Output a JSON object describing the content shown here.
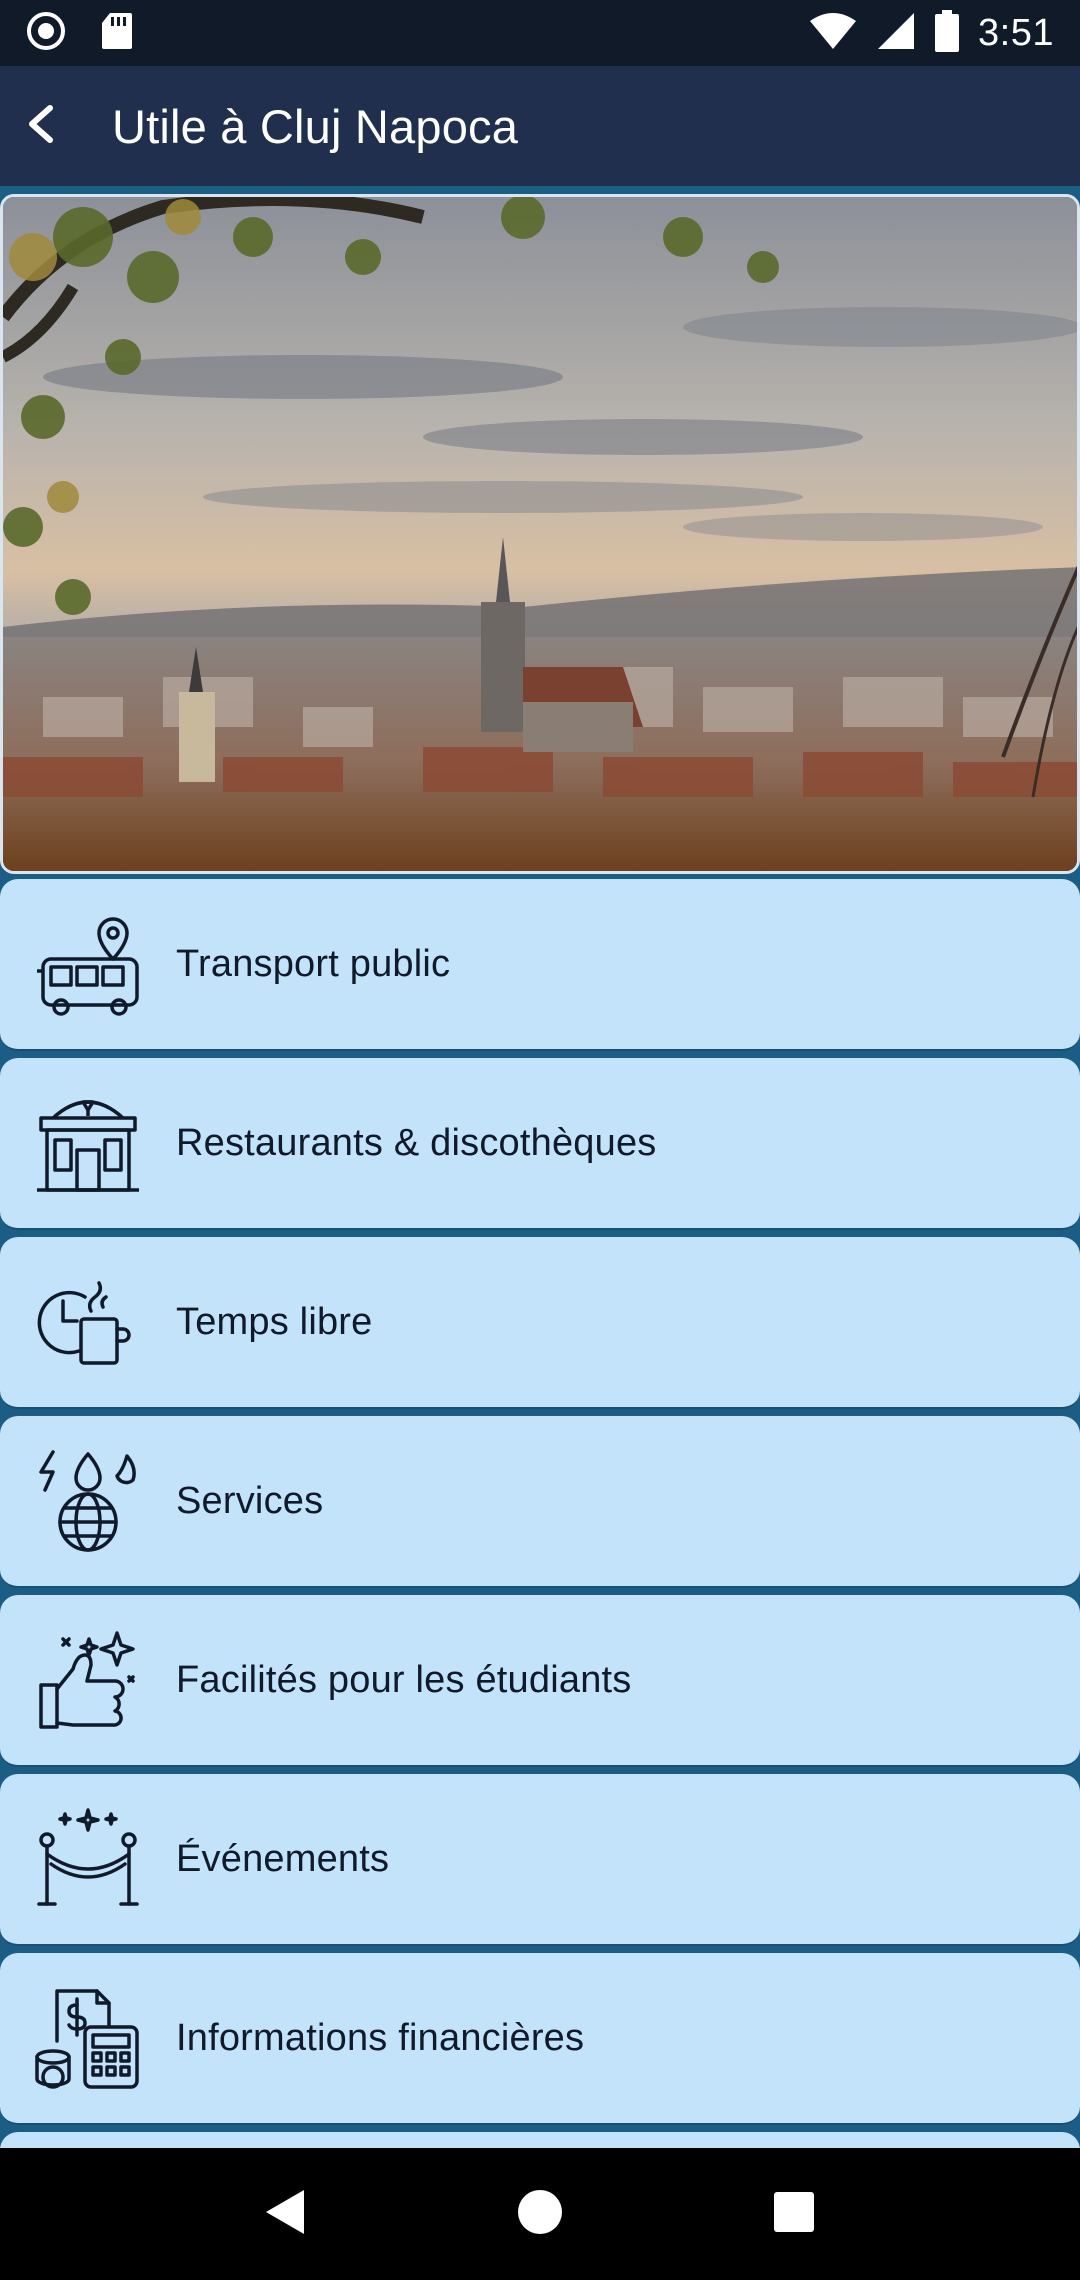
{
  "status_bar": {
    "time": "3:51",
    "icons": [
      "notification-circle-icon",
      "sd-card-icon",
      "wifi-icon",
      "signal-icon",
      "battery-icon"
    ]
  },
  "app_bar": {
    "title": "Utile à Cluj Napoca",
    "back_icon": "back-arrow-icon"
  },
  "hero": {
    "image": "cluj-napoca-cityscape"
  },
  "menu": [
    {
      "label": "Transport public",
      "icon": "bus-location-icon"
    },
    {
      "label": "Restaurants & discothèques",
      "icon": "restaurant-building-icon"
    },
    {
      "label": "Temps libre",
      "icon": "clock-coffee-icon"
    },
    {
      "label": "Services",
      "icon": "globe-utilities-icon"
    },
    {
      "label": "Facilités pour les étudiants",
      "icon": "thumbs-up-sparkle-icon"
    },
    {
      "label": "Événements",
      "icon": "event-rope-barrier-icon"
    },
    {
      "label": "Informations financières",
      "icon": "finance-calculator-icon"
    }
  ],
  "nav_bar": {
    "icons": [
      "nav-back-icon",
      "nav-home-icon",
      "nav-recents-icon"
    ]
  },
  "colors": {
    "app_bar": "#1f2f4d",
    "content_bg": "#1c5d86",
    "card_bg": "#c3e3fb",
    "text": "#101a2a"
  }
}
